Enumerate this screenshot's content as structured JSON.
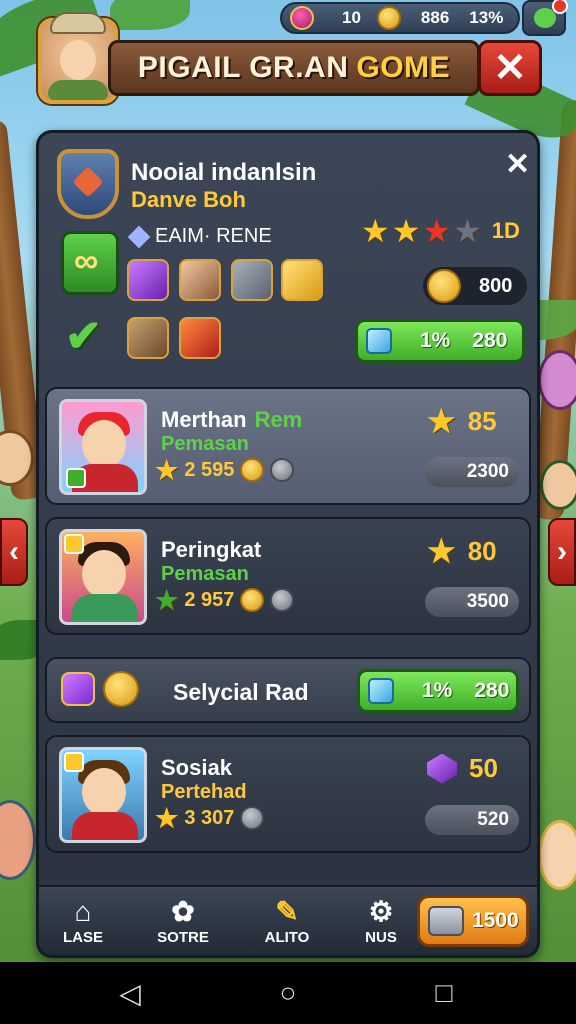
{
  "topbar": {
    "gems": "10",
    "coins": "886",
    "percent": "13%"
  },
  "title": {
    "main": "PIGAIL GR.AN",
    "highlight": "GOME"
  },
  "profile": {
    "name": "Nooial indanlsin",
    "subtitle": "Danve Boh",
    "rank": "EAIM· RENE",
    "stars_value": "1D",
    "coins": "800",
    "boost_percent": "1%",
    "boost_value": "280"
  },
  "cards": [
    {
      "name": "Merthan",
      "tag": "Rem",
      "sub": "Pemasan",
      "stat": "2 595",
      "score": "85",
      "pill": "2300"
    },
    {
      "name": "Peringkat",
      "sub": "Pemasan",
      "stat": "2 957",
      "score": "80",
      "pill": "3500"
    },
    {
      "name": "Sosiak",
      "sub": "Pertehad",
      "stat": "3 307",
      "score": "50",
      "pill": "520"
    }
  ],
  "special": {
    "label": "Selycial Rad",
    "percent": "1%",
    "value": "280"
  },
  "nav": {
    "items": [
      "LASE",
      "SOTRE",
      "ALITO",
      "NUS"
    ],
    "store_value": "1500"
  },
  "colors": {
    "accent_gold": "#ffc93a",
    "accent_green": "#5fd04a",
    "close_red": "#e8473a"
  }
}
